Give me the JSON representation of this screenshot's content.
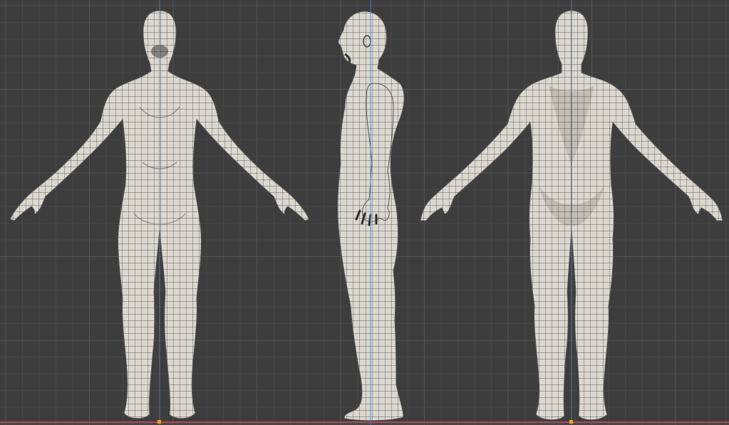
{
  "viewport": {
    "name": "3d-viewport",
    "background": "#3d3d3d",
    "grid_minor_color": "#474747",
    "grid_major_color": "#555555",
    "z_axis_color": "#4a88c8",
    "x_axis_color": "#b04a57",
    "origin_color": "#ff9f1a"
  },
  "mesh": {
    "base_color": "#dcd8cf",
    "shade_color": "#b8b3a8",
    "wire_color": "#2a2a2a",
    "views": [
      "front",
      "side",
      "back"
    ]
  }
}
